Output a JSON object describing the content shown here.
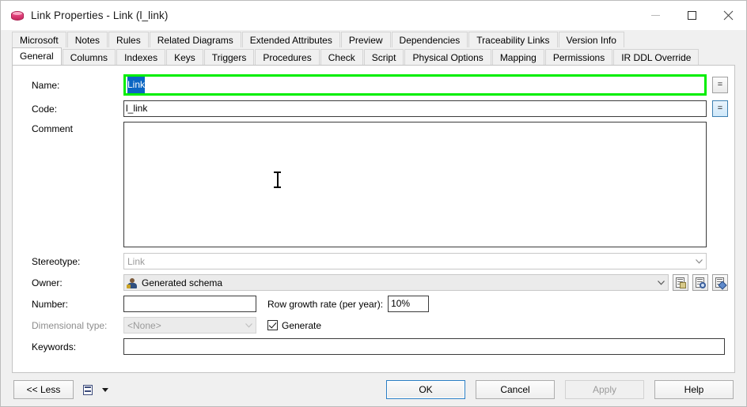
{
  "window": {
    "title": "Link Properties - Link (l_link)",
    "icon": "database-cylinder-icon",
    "minimize_label": "Minimize",
    "maximize_label": "Maximize",
    "close_label": "Close"
  },
  "tabs": {
    "row1": [
      {
        "label": "Microsoft",
        "active": false
      },
      {
        "label": "Notes",
        "active": false
      },
      {
        "label": "Rules",
        "active": false
      },
      {
        "label": "Related Diagrams",
        "active": false
      },
      {
        "label": "Extended Attributes",
        "active": false
      },
      {
        "label": "Preview",
        "active": false
      },
      {
        "label": "Dependencies",
        "active": false
      },
      {
        "label": "Traceability Links",
        "active": false
      },
      {
        "label": "Version Info",
        "active": false
      }
    ],
    "row2": [
      {
        "label": "General",
        "active": true
      },
      {
        "label": "Columns",
        "active": false
      },
      {
        "label": "Indexes",
        "active": false
      },
      {
        "label": "Keys",
        "active": false
      },
      {
        "label": "Triggers",
        "active": false
      },
      {
        "label": "Procedures",
        "active": false
      },
      {
        "label": "Check",
        "active": false
      },
      {
        "label": "Script",
        "active": false
      },
      {
        "label": "Physical Options",
        "active": false
      },
      {
        "label": "Mapping",
        "active": false
      },
      {
        "label": "Permissions",
        "active": false
      },
      {
        "label": "IR DDL Override",
        "active": false
      }
    ]
  },
  "form": {
    "name": {
      "label": "Name:",
      "value": "Link",
      "selected": true,
      "highlight_color": "#00ee00",
      "selection_color": "#0b66c3",
      "equals_button": "="
    },
    "code": {
      "label": "Code:",
      "value": "l_link",
      "equals_button": "="
    },
    "comment": {
      "label": "Comment",
      "value": ""
    },
    "stereotype": {
      "label": "Stereotype:",
      "value": "Link",
      "disabled": true
    },
    "owner": {
      "label": "Owner:",
      "value": "Generated schema",
      "icon": "user-icon",
      "buttons": [
        "create-owner-button",
        "owner-properties-button",
        "edit-owner-button"
      ]
    },
    "number": {
      "label": "Number:",
      "value": ""
    },
    "row_growth_rate": {
      "label": "Row growth rate (per year):",
      "value": "10%"
    },
    "dimensional_type": {
      "label": "Dimensional type:",
      "value": "<None>",
      "disabled": true
    },
    "generate": {
      "label": "Generate",
      "checked": true
    },
    "keywords": {
      "label": "Keywords:",
      "value": ""
    }
  },
  "footer": {
    "less": "<< Less",
    "menu_icon": "list-menu-icon",
    "ok": "OK",
    "cancel": "Cancel",
    "apply": "Apply",
    "apply_disabled": true,
    "help": "Help"
  }
}
